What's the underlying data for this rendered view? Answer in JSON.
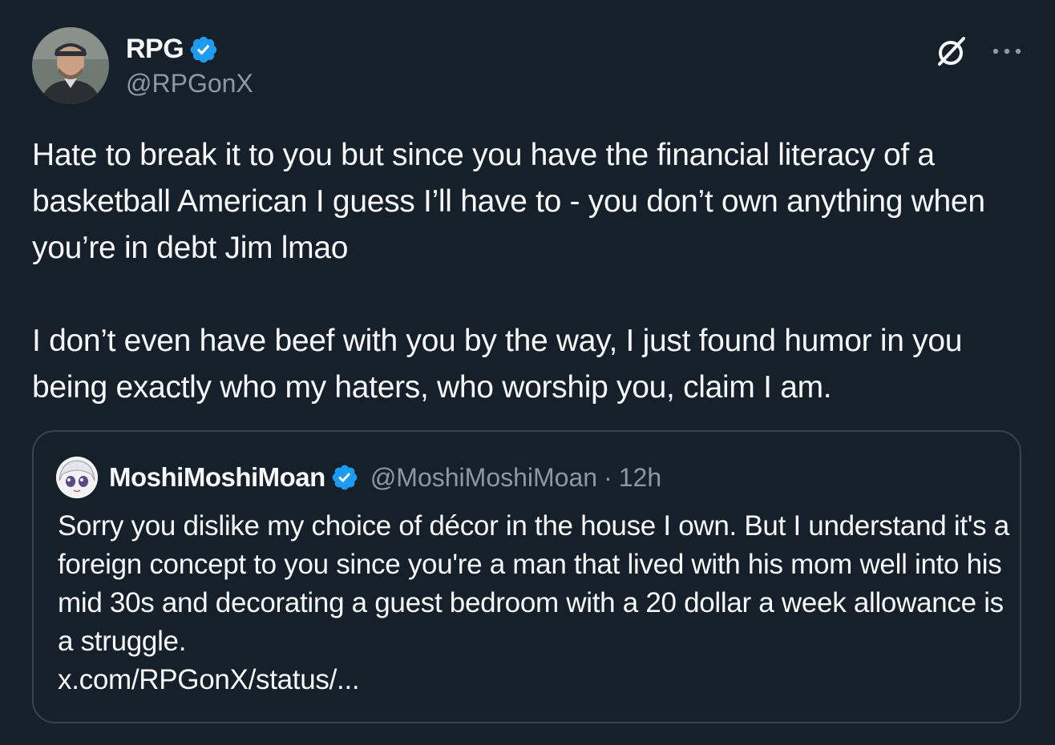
{
  "post": {
    "author_name": "RPG",
    "author_handle": "@RPGonX",
    "text_paragraphs": [
      "Hate to break it to you but since you have the financial literacy of a basketball American I guess I’ll have to - you don’t own anything when you’re in debt Jim lmao",
      "I don’t even have beef with you by the way, I just found humor in you being exactly who my haters, who worship you, claim I am."
    ]
  },
  "quoted_post": {
    "author_name": "MoshiMoshiMoan",
    "author_handle": "@MoshiMoshiMoan",
    "separator": "·",
    "time": "12h",
    "text": "Sorry you dislike my choice of décor in the house I own.  But I understand it's a foreign concept to you since you're a man that lived with his mom well into his mid 30s and decorating a guest bedroom with a 20 dollar a week allowance is a struggle.",
    "link": "x.com/RPGonX/status/..."
  },
  "icons": {
    "verified": "verified-badge-icon",
    "grok": "grok-icon",
    "more": "more-options-icon"
  },
  "colors": {
    "background": "#15202b",
    "text": "#f7f9f9",
    "secondary_text": "#8b98a5",
    "verified_blue": "#1d9bf0",
    "border": "#38444d"
  }
}
